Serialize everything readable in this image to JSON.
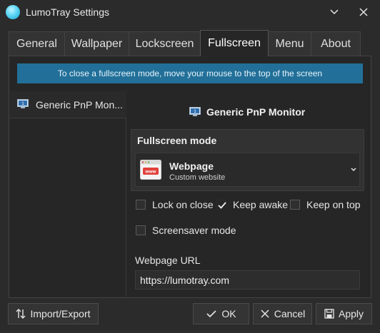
{
  "window": {
    "title": "LumoTray Settings",
    "controls": {
      "menu": "chevron-down-icon",
      "close": "close-icon"
    }
  },
  "tabs": [
    {
      "label": "General",
      "active": false
    },
    {
      "label": "Wallpaper",
      "active": false
    },
    {
      "label": "Lockscreen",
      "active": false
    },
    {
      "label": "Fullscreen",
      "active": true
    },
    {
      "label": "Menu",
      "active": false
    },
    {
      "label": "About",
      "active": false
    }
  ],
  "banner": {
    "text": "To close a fullscreen mode, move your mouse to the top of the screen"
  },
  "monitors": {
    "items": [
      {
        "label": "Generic PnP Mon...",
        "badge": "1"
      }
    ]
  },
  "selected_monitor": {
    "name": "Generic PnP Monitor",
    "badge": "1"
  },
  "fullscreen_mode": {
    "heading": "Fullscreen mode",
    "selected": {
      "name": "Webpage",
      "description": "Custom website",
      "icon_text": "www"
    }
  },
  "options": {
    "lock_on_close": {
      "label": "Lock on close",
      "checked": false
    },
    "keep_awake": {
      "label": "Keep awake",
      "checked": true
    },
    "keep_on_top": {
      "label": "Keep on top",
      "checked": false
    },
    "screensaver_mode": {
      "label": "Screensaver mode",
      "checked": false
    }
  },
  "webpage": {
    "label": "Webpage URL",
    "value": "https://lumotray.com",
    "placeholder": ""
  },
  "buttons": {
    "import_export": "Import/Export",
    "ok": "OK",
    "cancel": "Cancel",
    "apply": "Apply"
  },
  "colors": {
    "banner": "#227099",
    "background": "#2b2b2b",
    "panel": "#262626"
  }
}
